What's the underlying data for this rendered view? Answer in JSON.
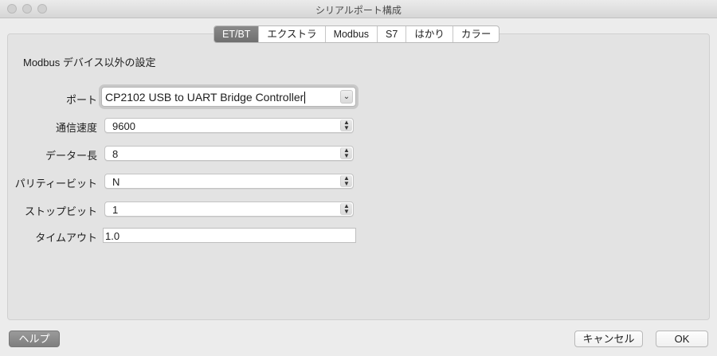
{
  "window": {
    "title": "シリアルポート構成"
  },
  "tabs": [
    {
      "label": "ET/BT",
      "active": true
    },
    {
      "label": "エクストラ",
      "active": false
    },
    {
      "label": "Modbus",
      "active": false
    },
    {
      "label": "S7",
      "active": false
    },
    {
      "label": "はかり",
      "active": false
    },
    {
      "label": "カラー",
      "active": false
    }
  ],
  "section": {
    "title": "Modbus デバイス以外の設定"
  },
  "fields": {
    "port": {
      "label": "ポート",
      "value": "CP2102 USB to UART Bridge Controller"
    },
    "baud": {
      "label": "通信速度",
      "value": "9600"
    },
    "databits": {
      "label": "データー長",
      "value": "8"
    },
    "parity": {
      "label": "パリティービット",
      "value": "N"
    },
    "stopbits": {
      "label": "ストップビット",
      "value": "1"
    },
    "timeout": {
      "label": "タイムアウト",
      "value": "1.0"
    }
  },
  "buttons": {
    "help": "ヘルプ",
    "cancel": "キャンセル",
    "ok": "OK"
  },
  "icons": {
    "stepper": "up-down-arrows-icon",
    "dropdown": "chevron-down-icon"
  },
  "colors": {
    "active_tab": "#7a7a7a",
    "window_bg": "#ececec"
  }
}
